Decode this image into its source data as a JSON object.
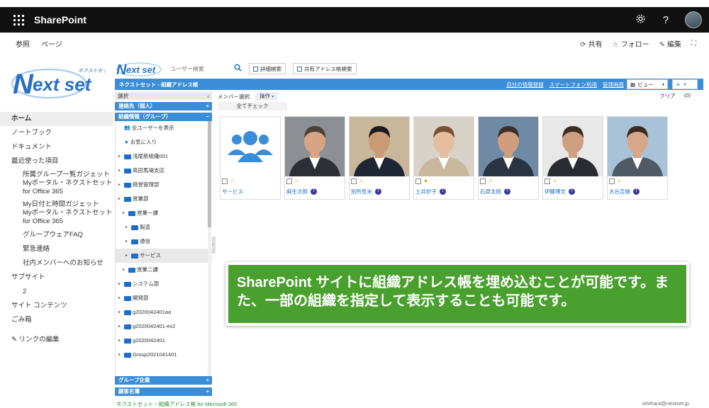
{
  "topbar": {
    "app_name": "SharePoint",
    "icons": [
      "waffle-icon",
      "gear-icon",
      "help-icon",
      "avatar"
    ],
    "help_glyph": "?"
  },
  "command_bar": {
    "left": [
      "参照",
      "ページ"
    ],
    "share": "共有",
    "follow": "フォロー",
    "edit": "編集"
  },
  "logo": {
    "text": "Nextset",
    "sub": "ネクストセット"
  },
  "leftnav": {
    "home": "ホーム",
    "notebook": "ノートブック",
    "documents": "ドキュメント",
    "recent": "最近使った項目",
    "recent_items": [
      "所属グループ一覧ガジェット",
      "Myポータル・ネクストセット",
      "for Office 365",
      "My日付と時間ガジェット",
      "Myポータル・ネクストセット",
      "for Office 365",
      "グループウェアFAQ",
      "緊急連絡",
      "社内メンバーへのお知らせ"
    ],
    "subsite": "サブサイト",
    "subsite_item": "2",
    "site_contents": "サイト コンテンツ",
    "recycle_bin": "ごみ箱",
    "edit_links": "リンクの編集"
  },
  "app": {
    "logo_text": "Nextset",
    "user_search_placeholder": "ユーザー検索",
    "detail_search": "詳細検索",
    "shared_search": "共有アドレス帳検索",
    "title": "ネクストセット - 組織アドレス帳",
    "links": [
      "自分の情報登録",
      "スマートフォン利用",
      "管理画面"
    ],
    "view_label": "ビュー",
    "footer_left": "ネクストセット・組織アドレス帳 for Microsoft 365",
    "footer_right": "ishihara@nextset.jp"
  },
  "sidepanel": {
    "select": "選択",
    "contacts": "連絡先（個人）",
    "org_info": "組織情報（グループ）",
    "tree": [
      {
        "label": "全ユーザーを表示",
        "icon": "users-icon",
        "level": 0
      },
      {
        "label": "お気に入り",
        "icon": "star-icon",
        "level": 0
      },
      {
        "label": "浅尾新組織001",
        "icon": "folder-icon",
        "level": 0
      },
      {
        "label": "高田馬場支店",
        "icon": "folder-icon",
        "level": 0
      },
      {
        "label": "経営管理部",
        "icon": "folder-icon",
        "level": 0
      },
      {
        "label": "営業部",
        "icon": "folder-icon",
        "level": 0
      },
      {
        "label": "営業一課",
        "icon": "folder-icon",
        "level": 1
      },
      {
        "label": "製造",
        "icon": "folder-icon",
        "level": 2
      },
      {
        "label": "通信",
        "icon": "folder-icon",
        "level": 2
      },
      {
        "label": "サービス",
        "icon": "folder-icon",
        "level": 2
      },
      {
        "label": "営業二課",
        "icon": "folder-icon",
        "level": 1
      },
      {
        "label": "システム部",
        "icon": "folder-icon",
        "level": 0
      },
      {
        "label": "開発部",
        "icon": "folder-icon",
        "level": 0
      },
      {
        "label": "g2020042401aa",
        "icon": "folder-icon",
        "level": 0
      },
      {
        "label": "g2020042401-ex2",
        "icon": "folder-icon",
        "level": 0
      },
      {
        "label": "g2020042401",
        "icon": "folder-icon",
        "level": 0
      },
      {
        "label": "Group2021041401",
        "icon": "folder-icon",
        "level": 0
      }
    ],
    "group_company": "グループ企業",
    "customer_list": "顧客名簿"
  },
  "main": {
    "member_select": "メンバー選択:",
    "operation": "操作",
    "clear": "クリア",
    "count": "(0)",
    "check_all": "全てチェック",
    "cards": [
      {
        "name": "サービス",
        "type": "group",
        "starred": false,
        "badge": false
      },
      {
        "name": "麻生次郎",
        "type": "person",
        "starred": false,
        "badge": true,
        "bg": "#8c8f93",
        "suit": "#2d2f36",
        "skin": "#d7a585",
        "hair": "#4d4037"
      },
      {
        "name": "別所哲夫",
        "type": "person",
        "starred": false,
        "badge": true,
        "bg": "#c9b79b",
        "suit": "#1d2635",
        "skin": "#c99a74",
        "hair": "#1c1a1a"
      },
      {
        "name": "土井妙子",
        "type": "person",
        "starred": true,
        "badge": true,
        "bg": "#d9d2c9",
        "suit": "#c9b79e",
        "skin": "#e5bd9f",
        "hair": "#7a4f34"
      },
      {
        "name": "石原太郎",
        "type": "person",
        "starred": false,
        "badge": true,
        "bg": "#6f8aa5",
        "suit": "#2b3442",
        "skin": "#d09d7f",
        "hair": "#3e3028"
      },
      {
        "name": "伊藤博文",
        "type": "person",
        "starred": false,
        "badge": true,
        "bg": "#e8e8e8",
        "suit": "#2a2c31",
        "skin": "#cf9f82",
        "hair": "#3a2d24"
      },
      {
        "name": "大谷吉継",
        "type": "person",
        "starred": false,
        "badge": true,
        "bg": "#a8c3d8",
        "suit": "#505a66",
        "skin": "#d8a689",
        "hair": "#3a2a1f"
      }
    ],
    "badge_letter": "T"
  },
  "callout": {
    "text": "SharePoint サイトに組織アドレス帳を埋め込むことが可能です。また、一部の組織を指定して表示することも可能です。"
  },
  "colors": {
    "topbar": "#111111",
    "accent_blue": "#3c8dd8",
    "callout_green": "#4aa02e",
    "star": "#e0a000"
  }
}
